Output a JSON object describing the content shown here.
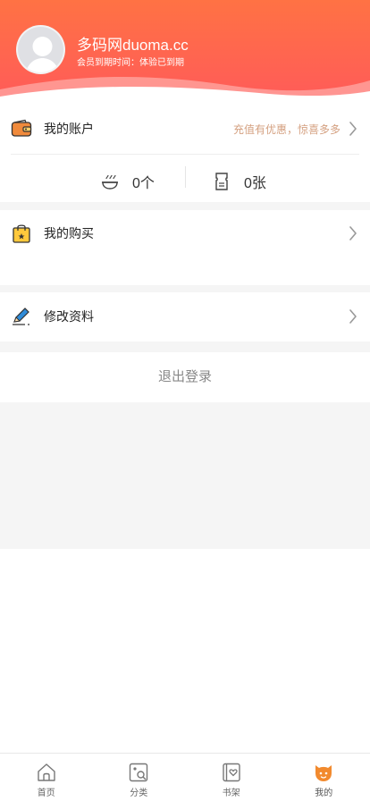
{
  "header": {
    "username": "多码网duoma.cc",
    "member_status": "会员到期时间：体验已到期"
  },
  "account": {
    "label": "我的账户",
    "hint": "充值有优惠，惊喜多多",
    "coins_value": "0个",
    "tickets_value": "0张"
  },
  "purchase": {
    "label": "我的购买"
  },
  "profile": {
    "label": "修改资料"
  },
  "logout": {
    "label": "退出登录"
  },
  "tabbar": {
    "items": [
      {
        "label": "首页",
        "icon": "home-icon"
      },
      {
        "label": "分类",
        "icon": "category-icon"
      },
      {
        "label": "书架",
        "icon": "bookshelf-icon"
      },
      {
        "label": "我的",
        "icon": "me-icon"
      }
    ],
    "active_index": 3
  },
  "colors": {
    "header_gradient_top": "#ff7244",
    "header_gradient_bottom": "#ff5a5a",
    "hint": "#d4a080",
    "active_tab": "#f28a2e"
  }
}
